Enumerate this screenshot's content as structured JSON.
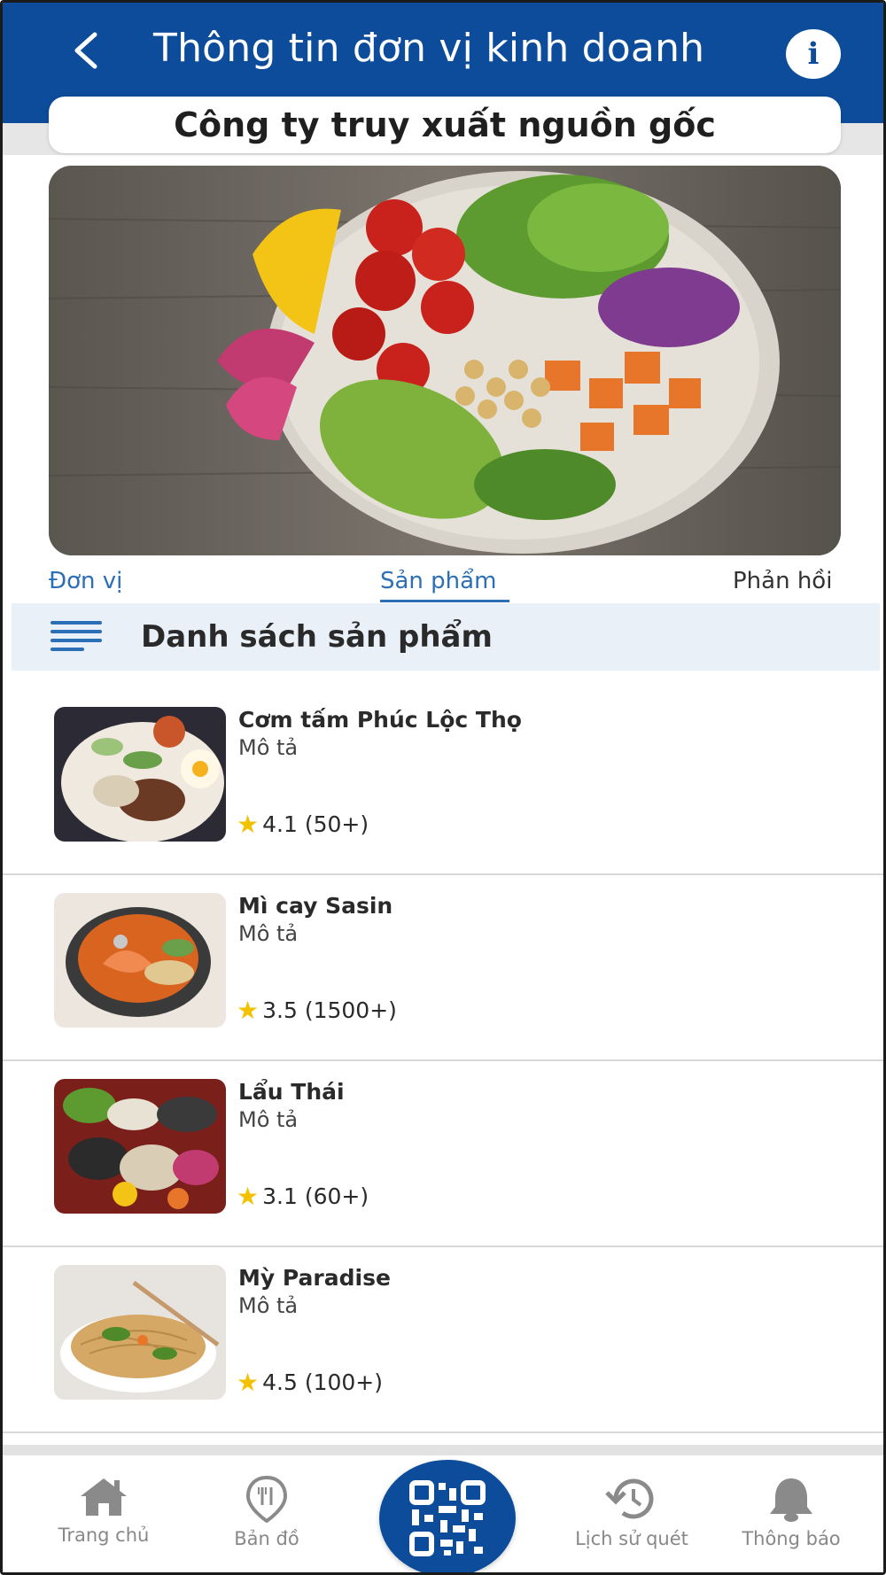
{
  "header": {
    "title": "Thông tin đơn vị kinh doanh",
    "back_icon": "chevron-left-icon",
    "info_icon": "info-icon",
    "brand_color": "#0c4c9b"
  },
  "company": {
    "name": "Công ty truy xuất nguồn gốc"
  },
  "tabs": [
    {
      "label": "Đơn vị",
      "active": false
    },
    {
      "label": "Sản phẩm",
      "active": true
    },
    {
      "label": "Phản hồi",
      "active": false
    }
  ],
  "section": {
    "title": "Danh sách sản phẩm",
    "icon": "menu-icon"
  },
  "products": [
    {
      "name": "Cơm tấm Phúc Lộc Thọ",
      "description": "Mô tả",
      "rating": "4.1 (50+)",
      "rating_value": 4.1
    },
    {
      "name": "Mì cay Sasin",
      "description": "Mô tả",
      "rating": "3.5 (1500+)",
      "rating_value": 3.5
    },
    {
      "name": "Lẩu Thái",
      "description": "Mô tả",
      "rating": "3.1 (60+)",
      "rating_value": 3.1
    },
    {
      "name": "Mỳ Paradise",
      "description": "Mô tả",
      "rating": "4.5 (100+)",
      "rating_value": 4.5
    }
  ],
  "rating_star": "★",
  "star_color": "#f2c200",
  "bottom_nav": [
    {
      "label": "Trang chủ",
      "icon": "home-icon"
    },
    {
      "label": "Bản đồ",
      "icon": "map-pin-icon"
    },
    {
      "label": "",
      "icon": "qr-code-icon"
    },
    {
      "label": "Lịch sử quét",
      "icon": "history-icon"
    },
    {
      "label": "Thông báo",
      "icon": "bell-icon"
    }
  ]
}
